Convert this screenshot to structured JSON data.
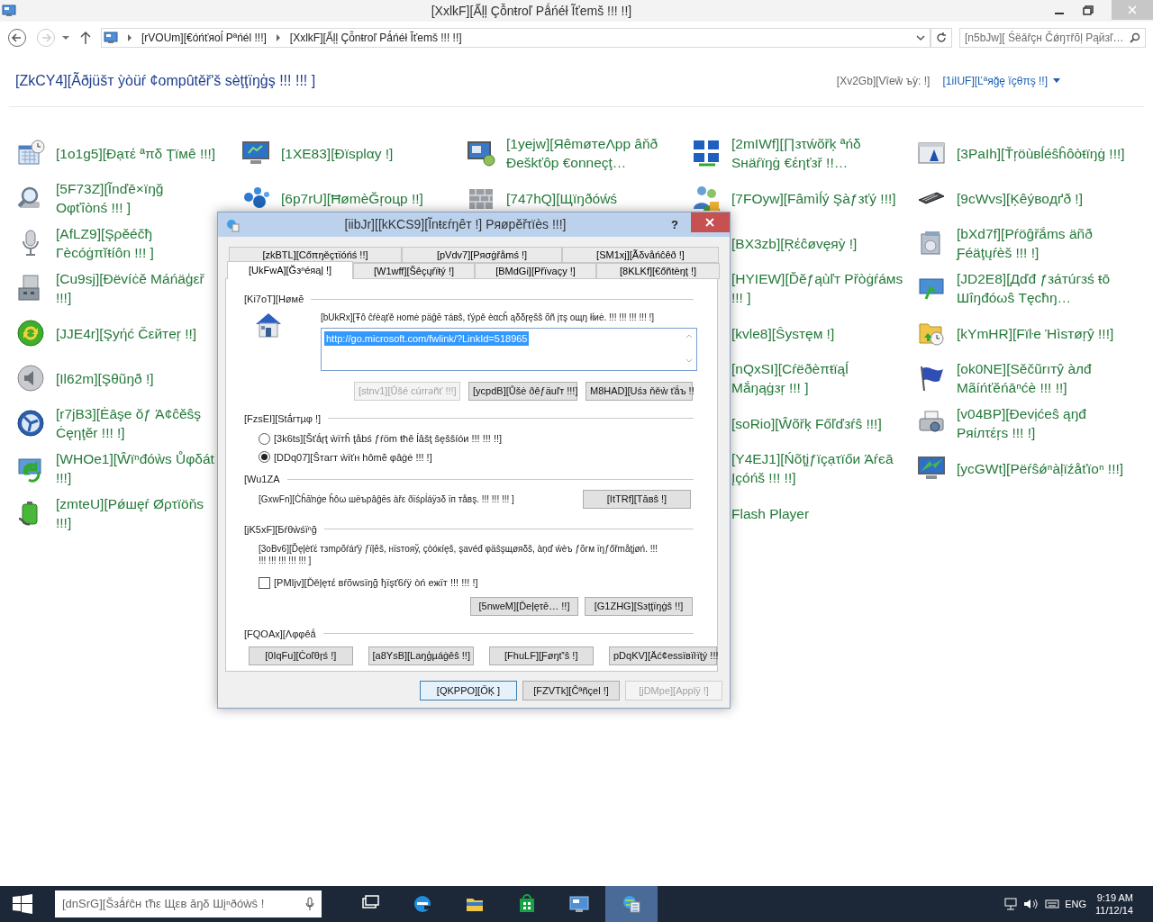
{
  "window": {
    "title": "[XxlkF][Ấļļ Çỗnŧroľ Pǻńéł Ĩťemš !!! !!]"
  },
  "address_bar": {
    "breadcrumbs": [
      "[rVOUm][€óńťяoĺ Pªńél !!!]",
      "[XxlkF][Ấļļ Çỗnŧroľ Pǻńéł Ĩťemš !!! !!]"
    ],
    "search_placeholder": "[n5bJw][ Śëǎřçн Čǿŋтřõḷ Рąйзľ…"
  },
  "header": {
    "title": "[ZkCY4][Ãðjüšт ỳòüŕ ¢ompûtěř'š sèţţïŋģş !!! !!! ]",
    "view_by_label": "[Xv2Gb][Vîeŵ ъỳ: !]",
    "view_by_value": "[1iIUF][Ľªяğę ïçθπş !!]"
  },
  "columns": [
    {
      "items": [
        "[1o1g5][Đạτέ ªπδ Ţïмê !!!]",
        "[5F73Z][Ĩnďē×ïŋğ Oφťîònś !!! ]",
        "[AfLZ9][Şρěéčђ Γècóġπĭŧíôn !!! ]",
        "[Cu9sj][Đëvíċě Máńäģεř !!!]",
        "[JJE4r][Şyήć Čεйтeŗ !!]",
        "[Il62m][Şθũŋð !]",
        "[r7jB3][Ėāşe ŏƒ Ά¢ĉěŝş Ċęηţĕr !!! !]",
        "[WHOe1][Ŵïⁿđóẁs Ůφδát !!!]",
        "[zmteU][Ρǿшęŕ Øρτïöňs !!!]"
      ]
    },
    {
      "items": [
        "[1XE83][Ðïsplαy !]",
        "[6p7rU][ĦømèĞŗoцp !!]"
      ]
    },
    {
      "items": [
        "[1yejw][ЯêmøтeΛpp âňð Ðeškťôp €onneçţ…",
        "[747hQ][Щїŋðóẃś"
      ]
    },
    {
      "items": [
        "[2mIWf][∏зτẃõřķ ªńδ Sнäŕïŋġ €έηťзř !!…",
        "[7FOyw][Fâmìĺý Şàƒзťý !!!]",
        "[BX3zb][Ŗέĉøvęяỳ !]",
        "[HYIEW][Ďĕƒąùľт Přòġŕáмs !!! ]",
        "[kvle8][Ŝysтęм !]",
        "[nQxSI][Cŕëðèπŧïąĺ Mắŋąġзŗ !!! ]",
        "[soRio][Ŵõřķ Főľďзŕŝ !!!]",
        "[Y4EJ1][Ńõţįƒïçạτïőи Άŕєā Įçóńš !!! !!]",
        "Flash Player"
      ]
    },
    {
      "items": [
        "[3PaIh][Ťŗöùвĺéŝĥôòŧïŋġ !!!]",
        "[9cWvs][Ķêýвoдґð !]",
        "[bXd7f][Ρŕöĝřắms äñð Ƒéäţųŕèš !!! !]",
        "[JD2E8][Дďđ ƒзáтúгзś ŧō Шîŋđóωŝ Тęcħŋ…",
        "[kYmHR][Fïŀe Ήìsтøŗŷ !!!]",
        "[ok0NE][Sěčũrıтŷ àлđ Mãíńťĕńāⁿćè !!! !!]",
        "[v04BP][Ðevịćeŝ ąŋđ Pяίлτέŗs !!! !]",
        "[ycGWt][Pëŕŝǿⁿàļïźåťïoⁿ !!!]"
      ]
    }
  ],
  "dialog": {
    "title": "[iibJr][[kKCS9][Ĩnŧεŕŋêт !] Ρяøpĕřτïès !!!]",
    "help": "?",
    "tab_rows": [
      [
        {
          "label": "[zkBTL][Cőπŋěçτïóńś !!]",
          "selected": false
        },
        {
          "label": "[pVdv7][Pяσġřåmś !]",
          "selected": false
        },
        {
          "label": "[SM1xj][Ãδvåńĉêð !]",
          "selected": false
        }
      ],
      [
        {
          "label": "[UkFwA][Ğзⁿéяąļ !]",
          "selected": true
        },
        {
          "label": "[W1wff][Šêçųŕïŧý !]",
          "selected": false
        },
        {
          "label": "[BMdGi][Přïvaçy !]",
          "selected": false
        },
        {
          "label": "[8KLKf][€őñtèŋţ !]",
          "selected": false
        }
      ]
    ],
    "home": {
      "heading": "[Ki7oT][Høмĕ",
      "description": "[bUkRx][Ŧô ĉŕèąťě ноmė päĝē тáвš, ťýρě èαсĥ ąδδŗęšš õñ įτş ощŋ łίиė. !!! !!! !!! !!! !]",
      "url": "http://go.microsoft.com/fwlink/?LinkId=518965",
      "url_selected": true,
      "buttons": [
        {
          "label": "[stnv1][Ůšé cúrrəñť !!!]",
          "disabled": true
        },
        {
          "label": "[ycpdB][Ůšė ðêƒäuľт !!!]",
          "disabled": false
        },
        {
          "label": "M8HAD][Uśз ňěẁ ťǻъ !!",
          "disabled": false
        }
      ]
    },
    "startup": {
      "heading": "[FzsEI][Stắrтµφ !]",
      "options": [
        {
          "label": "[3k6ts][Šťǻŗţ ẁïтĥ ţåbś ƒŕöm ŧħê ĺâšţ šęššíóи !!! !!! !!]",
          "selected": false
        },
        {
          "label": "[DDq07][Ŝтaгт ẁïťн hômĕ φâġė !!! !]",
          "selected": true
        }
      ]
    },
    "tabs_section": {
      "heading": "[Wu1ZA",
      "description": "[GxwFn][Ċĥāŉġe ĥôω шëъpâĝēs àřε ðïśρĺáÿзδ ïп тåвş. !!! !!! !!! ]",
      "button": "[ItTRf][Τāвŝ !]"
    },
    "browsing_history": {
      "heading": "[jK5xF][Бŕθẁśïⁿğ",
      "description": "[3oBv6][Ďęļèťέ тзmρõŕáґÿ ƒïļĕš, нïsтояў, çòóкíęš, şavéđ φäŝşщøяδš, àņď ẃèъ ƒõгм ïŋƒőřmåţįøń. !!! !!! !!! !!! !!! !!! ]",
      "delete_on_exit": {
        "label": "[PMIjv][Ďěļęτέ вŕõwsïŋğ ђïşť6ŕÿ òń ежïт !!! !!! !]",
        "checked": false
      },
      "buttons": [
        "[5nweM][Ďeļęτē… !!]",
        "[G1ZHG][Sзţţïŋġš !!]"
      ]
    },
    "appearance": {
      "heading": "[FQOAx][Λφφêǻ",
      "buttons": [
        "[0IqFu][Ċoľθŗś !]",
        "[a8YsB][Laŋģµáġêŝ !!]",
        "[FhuLF][Ƒøŋť'ŝ !]",
        "pDqKV][Äć¢essïвïŀïţý !!!"
      ]
    },
    "footer_buttons": [
      {
        "label": "[QKPPO][ŐĶ ]",
        "default": true,
        "disabled": false
      },
      {
        "label": "[FZVTk][Ĉªñçel !]",
        "default": false,
        "disabled": false
      },
      {
        "label": "[jDMpe][Applÿ !]",
        "default": false,
        "disabled": true
      }
    ]
  },
  "taskbar": {
    "search_placeholder": "[dnSrG][Šзǻŕĉн ťħε Щεв ăŋδ Шįⁿðóẁŝ !",
    "apps": [
      {
        "selected": false
      },
      {
        "selected": false
      },
      {
        "selected": false
      },
      {
        "selected": false
      },
      {
        "selected": false
      },
      {
        "selected": true
      }
    ],
    "language": "ENG",
    "time": "9:19 AM",
    "date": "11/12/14"
  }
}
